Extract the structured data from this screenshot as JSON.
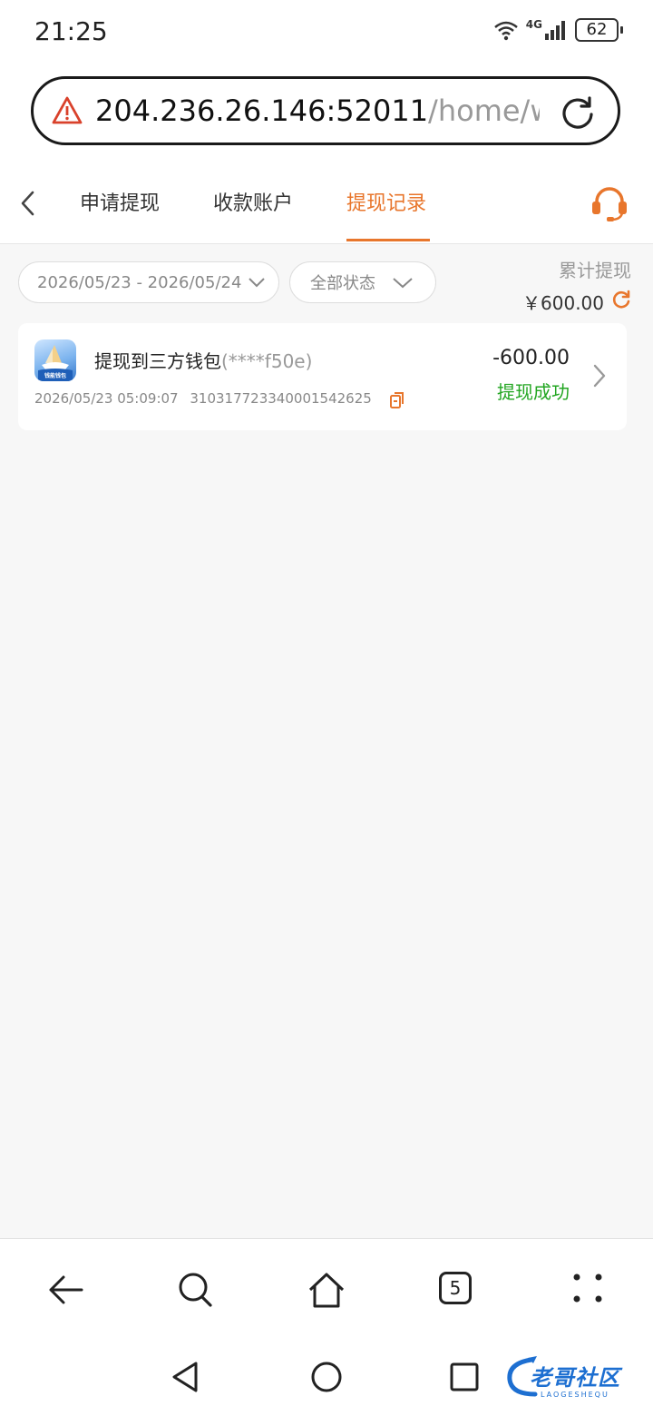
{
  "status_bar": {
    "time": "21:25",
    "network": "4G",
    "battery": "62"
  },
  "address_bar": {
    "host": "204.236.26.146:52011",
    "path": "/home/with",
    "warning_icon": "warning-triangle-icon",
    "reload_icon": "reload-icon"
  },
  "tabs": {
    "items": [
      {
        "label": "申请提现"
      },
      {
        "label": "收款账户"
      },
      {
        "label": "提现记录"
      }
    ],
    "active_index": 2,
    "accent_color": "#e8762c"
  },
  "filters": {
    "date_range": "2026/05/23 - 2026/05/24",
    "status": "全部状态"
  },
  "summary": {
    "label": "累计提现",
    "value": "￥600.00"
  },
  "records": [
    {
      "title": "提现到三方钱包",
      "masked_account": "(****f50e)",
      "datetime": "2026/05/23 05:09:07",
      "order_no": "310317723340001542625",
      "amount": "-600.00",
      "status": "提现成功",
      "logo_text": "钱能钱包"
    }
  ],
  "browser_nav": {
    "tab_count": "5"
  },
  "watermark": {
    "text": "老哥社区",
    "sub": "LAOGESHEQU"
  },
  "colors": {
    "accent": "#e8762c",
    "success": "#23a622"
  }
}
